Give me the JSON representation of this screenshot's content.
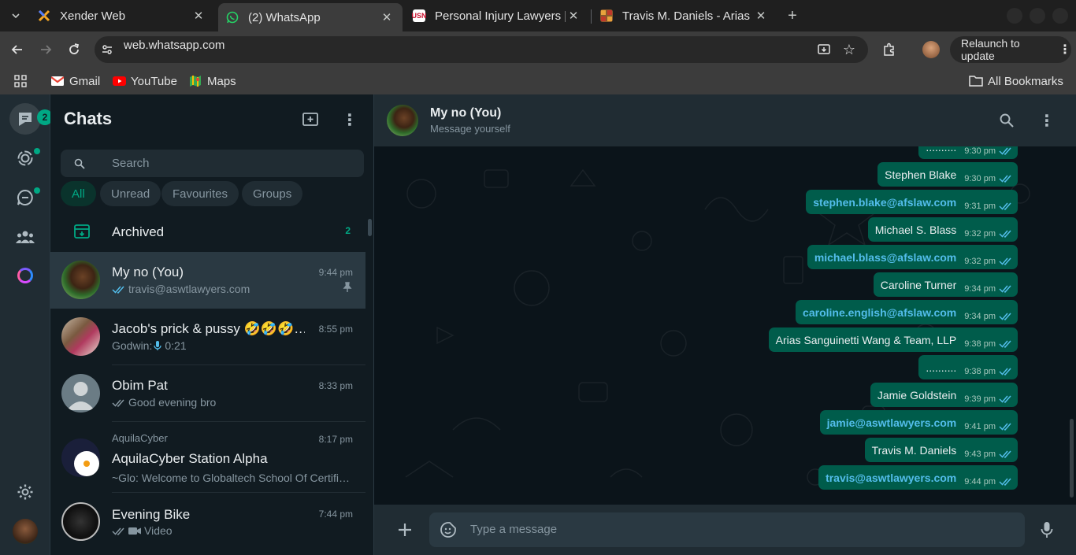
{
  "browser": {
    "tabs": [
      {
        "title": "Xender Web",
        "active": false
      },
      {
        "title": "(2) WhatsApp",
        "active": true
      },
      {
        "title": "Personal Injury Lawyers |",
        "active": false
      },
      {
        "title": "Travis M. Daniels - Arias S",
        "active": false
      }
    ],
    "url": "web.whatsapp.com",
    "relaunch_label": "Relaunch to update",
    "bookmarks": [
      {
        "label": "Gmail"
      },
      {
        "label": "YouTube"
      },
      {
        "label": "Maps"
      }
    ],
    "all_bookmarks_label": "All Bookmarks"
  },
  "rail": {
    "chats_badge": "2"
  },
  "sidebar": {
    "title": "Chats",
    "search_placeholder": "Search",
    "filters": [
      "All",
      "Unread",
      "Favourites",
      "Groups"
    ],
    "archived_label": "Archived",
    "archived_count": "2",
    "chats": [
      {
        "name": "My no (You)",
        "time": "9:44 pm",
        "preview": "travis@aswtlawyers.com",
        "sent_ticks": true,
        "pinned": true,
        "active": true
      },
      {
        "name": "Jacob's prick & pussy 🤣🤣🤣…",
        "time": "8:55 pm",
        "preview_sender": "Godwin: ",
        "preview": "0:21",
        "voice": true
      },
      {
        "name": "Obim Pat",
        "time": "8:33 pm",
        "preview": "Good evening bro",
        "sent_ticks": true
      },
      {
        "group": "AquilaCyber",
        "name": "AquilaCyber Station Alpha",
        "time": "8:17 pm",
        "preview": "~Glo: Welcome to Globaltech School Of Certifi…"
      },
      {
        "name": "Evening Bike",
        "time": "7:44 pm",
        "preview": "Video",
        "sent_ticks": true,
        "video": true
      }
    ]
  },
  "conversation": {
    "contact_name": "My no (You)",
    "contact_status": "Message yourself",
    "input_placeholder": "Type a message",
    "messages": [
      {
        "text": "..........",
        "time": "9:30 pm",
        "link": false
      },
      {
        "text": "Stephen Blake",
        "time": "9:30 pm",
        "link": false
      },
      {
        "text": "stephen.blake@afslaw.com",
        "time": "9:31 pm",
        "link": true
      },
      {
        "text": "Michael S. Blass",
        "time": "9:32 pm",
        "link": false
      },
      {
        "text": "michael.blass@afslaw.com",
        "time": "9:32 pm",
        "link": true
      },
      {
        "text": "Caroline Turner",
        "time": "9:34 pm",
        "link": false
      },
      {
        "text": "caroline.english@afslaw.com",
        "time": "9:34 pm",
        "link": true
      },
      {
        "text": "Arias Sanguinetti Wang & Team, LLP",
        "time": "9:38 pm",
        "link": false
      },
      {
        "text": "..........",
        "time": "9:38 pm",
        "link": false
      },
      {
        "text": "Jamie Goldstein",
        "time": "9:39 pm",
        "link": false
      },
      {
        "text": "jamie@aswtlawyers.com",
        "time": "9:41 pm",
        "link": true
      },
      {
        "text": "Travis M. Daniels",
        "time": "9:43 pm",
        "link": false
      },
      {
        "text": "travis@aswtlawyers.com",
        "time": "9:44 pm",
        "link": true
      }
    ]
  },
  "colors": {
    "accent": "#00a884",
    "outgoing_bubble": "#005c4b",
    "link": "#53bdeb",
    "panel": "#202c33",
    "background": "#111b21"
  }
}
